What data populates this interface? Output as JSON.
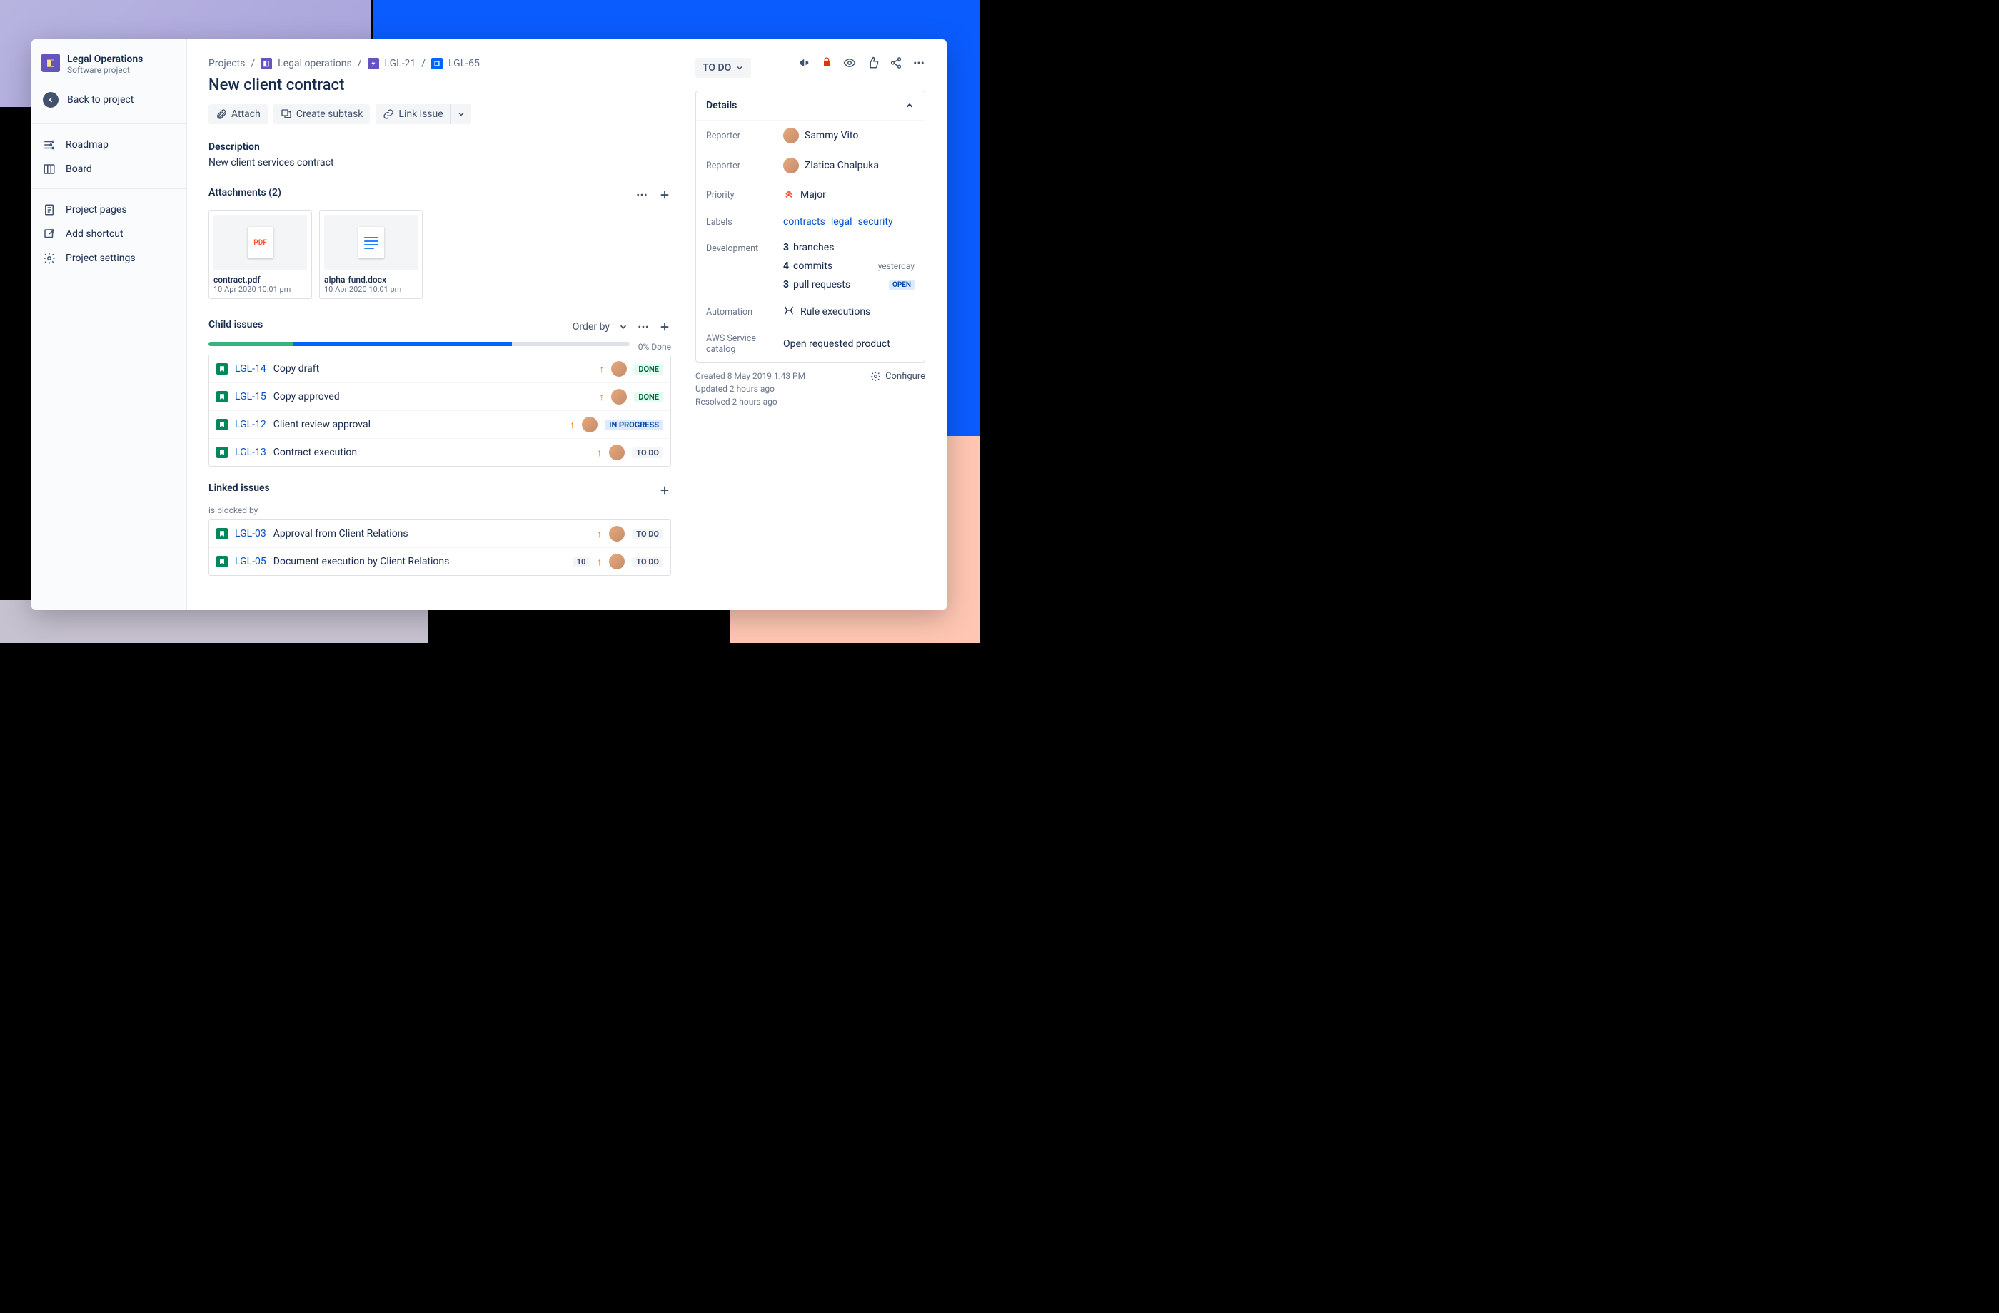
{
  "sidebar": {
    "project_name": "Legal Operations",
    "project_sub": "Software project",
    "back": "Back to project",
    "nav": [
      {
        "label": "Roadmap"
      },
      {
        "label": "Board"
      },
      {
        "label": "Project pages"
      },
      {
        "label": "Add shortcut"
      },
      {
        "label": "Project settings"
      }
    ]
  },
  "breadcrumb": {
    "projects": "Projects",
    "project": "Legal operations",
    "epic": "LGL-21",
    "story": "LGL-65"
  },
  "issue": {
    "title": "New client contract",
    "buttons": {
      "attach": "Attach",
      "subtask": "Create subtask",
      "link": "Link issue"
    },
    "desc_heading": "Description",
    "description": "New client services contract"
  },
  "attachments": {
    "heading": "Attachments (2)",
    "items": [
      {
        "name": "contract.pdf",
        "date": "10 Apr 2020 10:01 pm",
        "type": "pdf"
      },
      {
        "name": "alpha-fund.docx",
        "date": "10 Apr 2020 10:01 pm",
        "type": "docx"
      }
    ]
  },
  "child": {
    "heading": "Child issues",
    "order_by": "Order by",
    "progress_label": "0% Done",
    "progress_segments": [
      {
        "color": "#36b37e",
        "pct": 20
      },
      {
        "color": "#0065ff",
        "pct": 52
      },
      {
        "color": "#dfe1e6",
        "pct": 28
      }
    ],
    "items": [
      {
        "key": "LGL-14",
        "summary": "Copy draft",
        "status": "DONE",
        "status_class": "done"
      },
      {
        "key": "LGL-15",
        "summary": "Copy approved",
        "status": "DONE",
        "status_class": "done"
      },
      {
        "key": "LGL-12",
        "summary": "Client review approval",
        "status": "IN PROGRESS",
        "status_class": "prog"
      },
      {
        "key": "LGL-13",
        "summary": "Contract execution",
        "status": "TO DO",
        "status_class": "todo"
      }
    ]
  },
  "linked": {
    "heading": "Linked issues",
    "relation": "is blocked by",
    "items": [
      {
        "key": "LGL-03",
        "summary": "Approval from Client Relations",
        "status": "TO DO",
        "status_class": "todo"
      },
      {
        "key": "LGL-05",
        "summary": "Document execution by Client Relations",
        "status": "TO DO",
        "status_class": "todo",
        "count": "10"
      }
    ]
  },
  "panel": {
    "status": "TO DO",
    "details_heading": "Details",
    "reporter1_label": "Reporter",
    "reporter1": "Sammy Vito",
    "reporter2_label": "Reporter",
    "reporter2": "Zlatica Chalpuka",
    "priority_label": "Priority",
    "priority": "Major",
    "labels_label": "Labels",
    "labels": [
      "contracts",
      "legal",
      "security"
    ],
    "dev_label": "Development",
    "dev": [
      {
        "n": "3",
        "txt": "branches"
      },
      {
        "n": "4",
        "txt": "commits",
        "right": "yesterday"
      },
      {
        "n": "3",
        "txt": "pull requests",
        "right": "OPEN",
        "badge": true
      }
    ],
    "automation_label": "Automation",
    "automation": "Rule executions",
    "aws_label": "AWS Service catalog",
    "aws": "Open requested product",
    "created": "Created 8 May 2019 1:43 PM",
    "updated": "Updated 2 hours ago",
    "resolved": "Resolved 2 hours ago",
    "configure": "Configure"
  }
}
